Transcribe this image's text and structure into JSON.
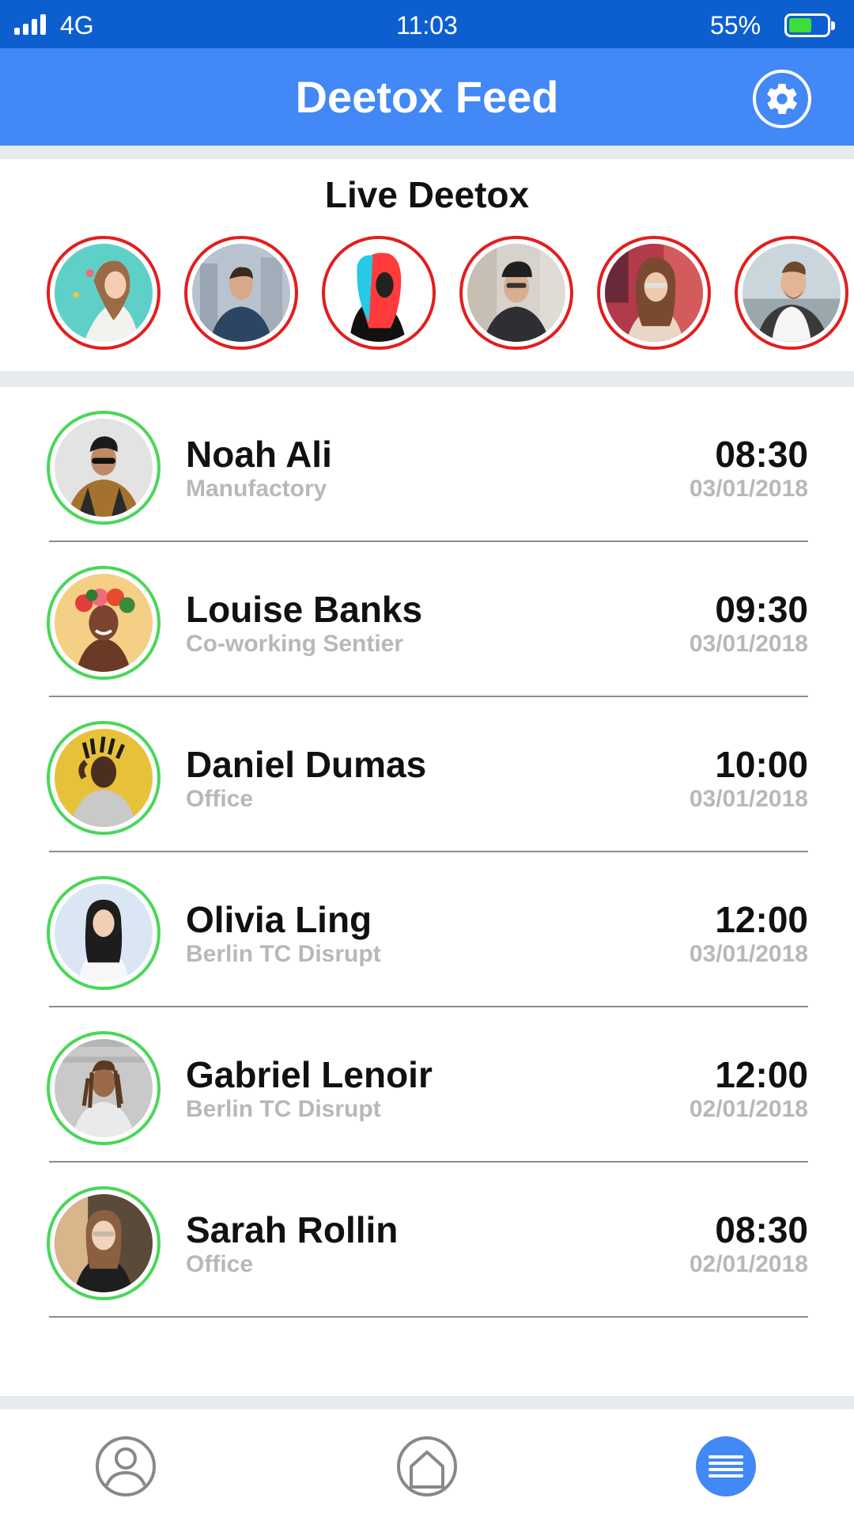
{
  "status_bar": {
    "carrier": "4G",
    "time": "11:03",
    "battery": "55%",
    "battery_level": 0.55,
    "icons": [
      "signal-icon",
      "battery-icon"
    ]
  },
  "header": {
    "title": "Deetox Feed",
    "settings_icon": "gear-icon"
  },
  "live": {
    "title": "Live Deetox",
    "ring_color": "#e41d1d",
    "avatars": [
      {
        "icon": "avatar-photo"
      },
      {
        "icon": "avatar-photo"
      },
      {
        "icon": "avatar-photo"
      },
      {
        "icon": "avatar-photo"
      },
      {
        "icon": "avatar-photo"
      },
      {
        "icon": "avatar-photo"
      }
    ]
  },
  "feed": {
    "ring_color": "#4bd65a",
    "items": [
      {
        "name": "Noah Ali",
        "place": "Manufactory",
        "time": "08:30",
        "date": "03/01/2018"
      },
      {
        "name": "Louise Banks",
        "place": "Co-working Sentier",
        "time": "09:30",
        "date": "03/01/2018"
      },
      {
        "name": "Daniel Dumas",
        "place": "Office",
        "time": "10:00",
        "date": "03/01/2018"
      },
      {
        "name": "Olivia Ling",
        "place": "Berlin TC Disrupt",
        "time": "12:00",
        "date": "03/01/2018"
      },
      {
        "name": "Gabriel Lenoir",
        "place": "Berlin TC Disrupt",
        "time": "12:00",
        "date": "02/01/2018"
      },
      {
        "name": "Sarah Rollin",
        "place": "Office",
        "time": "08:30",
        "date": "02/01/2018"
      }
    ]
  },
  "bottom_nav": {
    "items": [
      {
        "icon": "profile-icon",
        "active": false
      },
      {
        "icon": "home-icon",
        "active": false
      },
      {
        "icon": "menu-icon",
        "active": true
      }
    ],
    "active_color": "#4288f6"
  },
  "colors": {
    "status_bar": "#0d5fd0",
    "header": "#4288f6",
    "divider_band": "#e7ebef"
  }
}
